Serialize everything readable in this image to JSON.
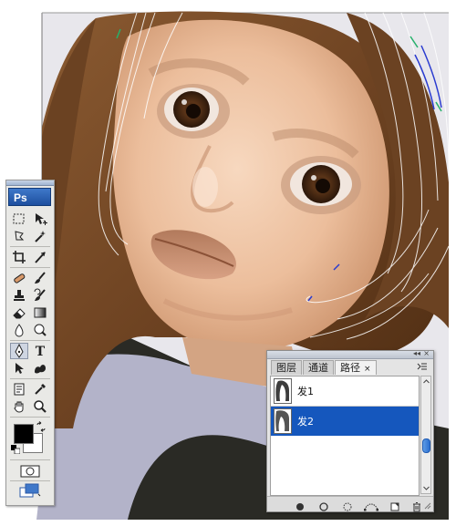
{
  "app": {
    "logo_text": "Ps"
  },
  "toolbox": {
    "tools": [
      {
        "name": "marquee-tool-icon"
      },
      {
        "name": "move-tool-icon"
      },
      {
        "name": "lasso-tool-icon"
      },
      {
        "name": "magic-wand-tool-icon"
      },
      {
        "name": "crop-tool-icon"
      },
      {
        "name": "slice-tool-icon"
      },
      {
        "name": "healing-brush-tool-icon"
      },
      {
        "name": "brush-tool-icon"
      },
      {
        "name": "clone-stamp-tool-icon"
      },
      {
        "name": "history-brush-tool-icon"
      },
      {
        "name": "eraser-tool-icon"
      },
      {
        "name": "gradient-tool-icon"
      },
      {
        "name": "blur-tool-icon"
      },
      {
        "name": "dodge-tool-icon"
      },
      {
        "name": "pen-tool-icon"
      },
      {
        "name": "type-tool-icon"
      },
      {
        "name": "path-selection-tool-icon"
      },
      {
        "name": "custom-shape-tool-icon"
      },
      {
        "name": "notes-tool-icon"
      },
      {
        "name": "eyedropper-tool-icon"
      },
      {
        "name": "hand-tool-icon"
      },
      {
        "name": "zoom-tool-icon"
      }
    ],
    "foreground_color": "#000000",
    "background_color": "#ffffff"
  },
  "panel": {
    "tabs": [
      {
        "label": "图层",
        "active": false
      },
      {
        "label": "通道",
        "active": false
      },
      {
        "label": "路径",
        "active": true
      }
    ],
    "tab_close_glyph": "×",
    "collapse_glyph": "◂◂",
    "close_glyph": "×",
    "paths": [
      {
        "label": "发1",
        "selected": false
      },
      {
        "label": "发2",
        "selected": true
      }
    ],
    "footer_buttons": [
      "fill-path-icon",
      "stroke-path-icon",
      "load-as-selection-icon",
      "make-work-path-icon",
      "new-path-icon",
      "delete-path-icon"
    ],
    "selection_color": "#1557bd"
  }
}
